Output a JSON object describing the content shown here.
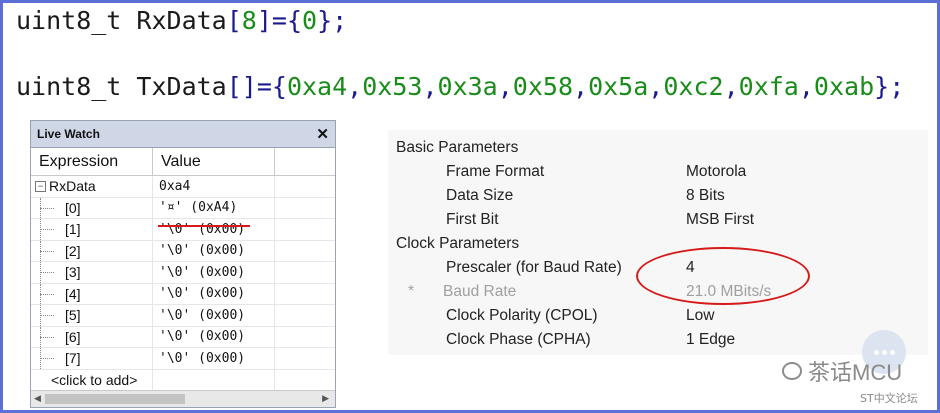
{
  "code": {
    "line1": {
      "type": "uint8_t",
      "name": "RxData",
      "open": "[",
      "size": "8",
      "close": "]={",
      "init": "0",
      "end": "};"
    },
    "line2": {
      "type": "uint8_t",
      "name": "TxData",
      "brackets": "[]={",
      "values": [
        "0xa4",
        "0x53",
        "0x3a",
        "0x58",
        "0x5a",
        "0xc2",
        "0xfa",
        "0xab"
      ],
      "end": "};"
    }
  },
  "live_watch": {
    "title": "Live Watch",
    "close_label": "✕",
    "headers": [
      "Expression",
      "Value"
    ],
    "root": {
      "expander": "−",
      "expression": "RxData",
      "value": "0xa4"
    },
    "children": [
      {
        "expression": "[0]",
        "value": "'¤' (0xA4)"
      },
      {
        "expression": "[1]",
        "value": "'\\0' (0x00)"
      },
      {
        "expression": "[2]",
        "value": "'\\0' (0x00)"
      },
      {
        "expression": "[3]",
        "value": "'\\0' (0x00)"
      },
      {
        "expression": "[4]",
        "value": "'\\0' (0x00)"
      },
      {
        "expression": "[5]",
        "value": "'\\0' (0x00)"
      },
      {
        "expression": "[6]",
        "value": "'\\0' (0x00)"
      },
      {
        "expression": "[7]",
        "value": "'\\0' (0x00)"
      }
    ],
    "add_placeholder": "<click to add>"
  },
  "parameters": {
    "basic_title": "Basic Parameters",
    "basic": [
      {
        "label": "Frame Format",
        "value": "Motorola"
      },
      {
        "label": "Data Size",
        "value": "8 Bits"
      },
      {
        "label": "First Bit",
        "value": "MSB First"
      }
    ],
    "clock_title": "Clock Parameters",
    "clock": [
      {
        "label": "Prescaler (for Baud Rate)",
        "value": "4"
      },
      {
        "label": "Baud Rate",
        "value": "21.0 MBits/s",
        "marker": "*"
      },
      {
        "label": "Clock Polarity (CPOL)",
        "value": "Low"
      },
      {
        "label": "Clock Phase (CPHA)",
        "value": "1 Edge"
      }
    ]
  },
  "watermark": {
    "brand": "茶话MCU",
    "forum": "ST中文论坛"
  },
  "colors": {
    "frame": "#5b6fd6",
    "highlight_red": "#d61a1a",
    "number_green": "#1a8c1a"
  }
}
